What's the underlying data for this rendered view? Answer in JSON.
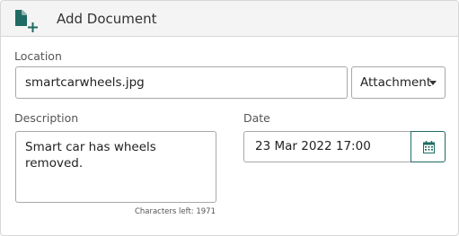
{
  "header": {
    "title": "Add Document",
    "icon": "add-document-icon",
    "icon_color": "#1f6b63"
  },
  "location": {
    "label": "Location",
    "value": "smartcarwheels.jpg",
    "type_dropdown": {
      "selected": "Attachment"
    }
  },
  "description": {
    "label": "Description",
    "value": "Smart car has wheels removed.",
    "chars_left": "Characters left: 1971"
  },
  "date": {
    "label": "Date",
    "value": "23 Mar 2022 17:00",
    "picker_icon": "calendar-icon"
  },
  "colors": {
    "accent": "#1f6b63",
    "border": "#a8a8a8",
    "header_bg": "#f4f4f4"
  }
}
